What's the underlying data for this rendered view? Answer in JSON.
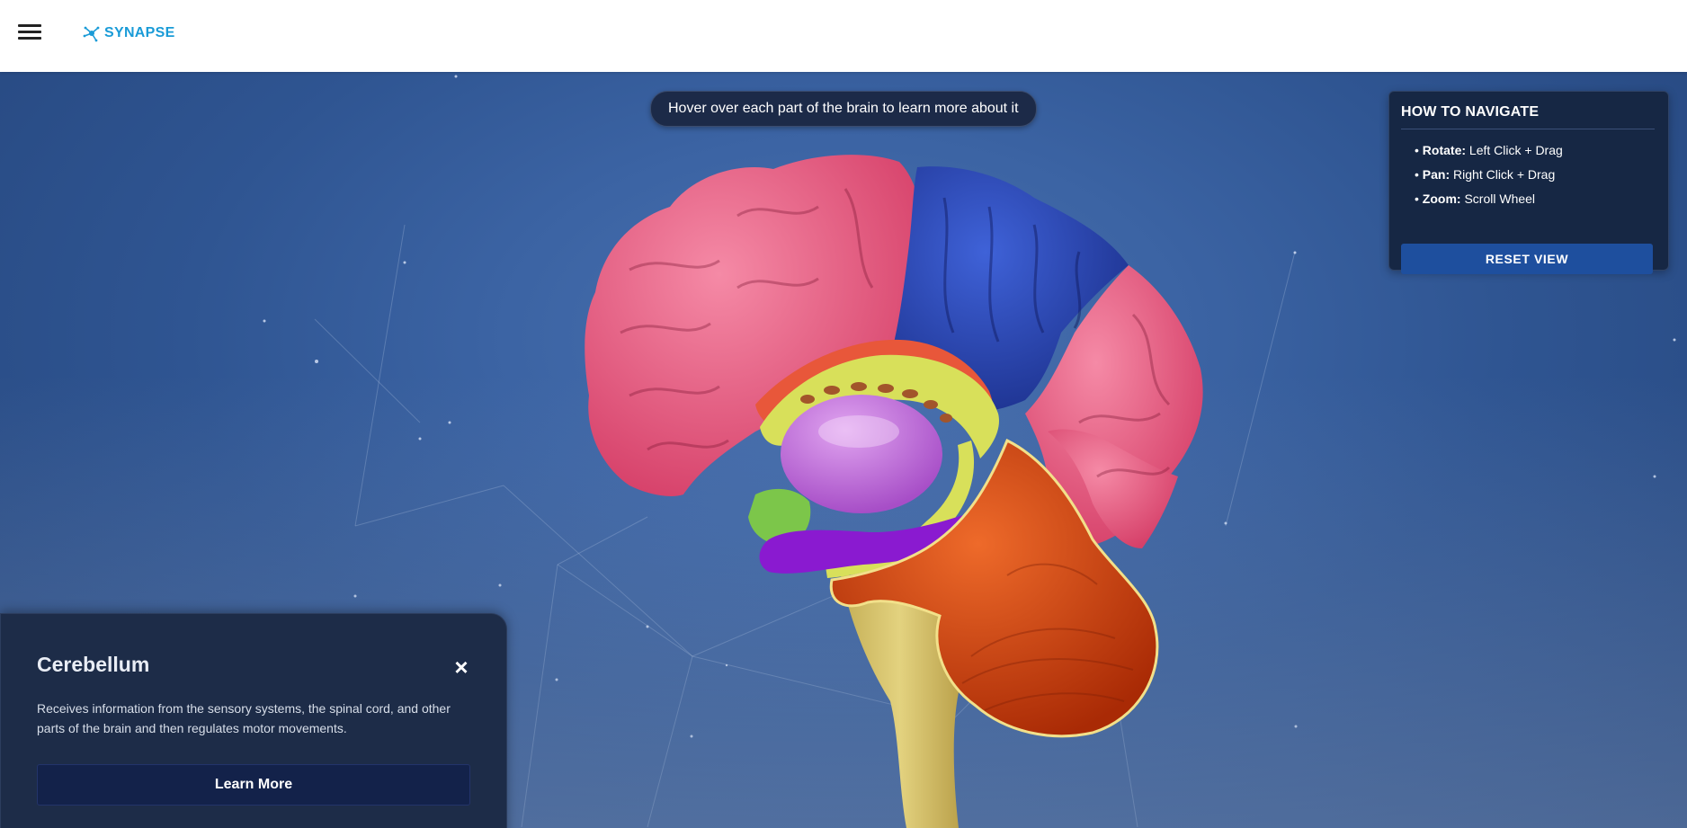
{
  "app": {
    "brand": "SYNAPSE",
    "brand_color": "#1a9bd7",
    "menu_icon": "hamburger-icon",
    "logo_icon": "neuron-icon"
  },
  "hint": "Hover over each part of the brain to learn more about it",
  "navigation": {
    "title": "HOW TO NAVIGATE",
    "items": [
      {
        "key": "Rotate:",
        "value": "Left Click + Drag"
      },
      {
        "key": "Pan:",
        "value": "Right Click + Drag"
      },
      {
        "key": "Zoom:",
        "value": "Scroll Wheel"
      }
    ],
    "reset_label": "RESET VIEW"
  },
  "info_card": {
    "title": "Cerebellum",
    "description": "Receives information from the sensory systems, the spinal cord, and other parts of the brain and then regulates motor movements.",
    "button_label": "Learn More",
    "close_icon": "close-icon"
  },
  "brain_regions": [
    {
      "name": "frontal-lobe",
      "color": "#e85a7d"
    },
    {
      "name": "parietal-lobe",
      "color": "#2846b8"
    },
    {
      "name": "occipital-lobe",
      "color": "#e85a7d"
    },
    {
      "name": "corpus-callosum",
      "color": "#e8a04a"
    },
    {
      "name": "cingulate",
      "color": "#d8e05a"
    },
    {
      "name": "thalamus",
      "color": "#c06ad8"
    },
    {
      "name": "hippocampus",
      "color": "#8a1ad0"
    },
    {
      "name": "cerebellum",
      "color": "#d8450f"
    },
    {
      "name": "brainstem",
      "color": "#d2c06a"
    },
    {
      "name": "hypothalamus",
      "color": "#7cc64a"
    }
  ]
}
